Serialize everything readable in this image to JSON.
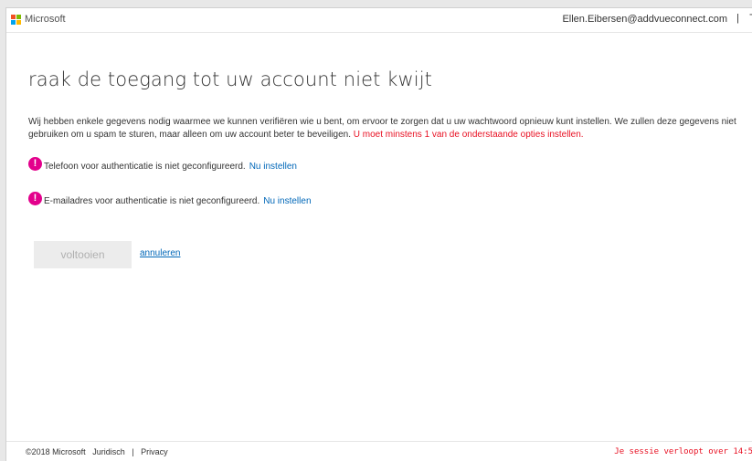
{
  "header": {
    "brand": "Microsoft",
    "logo_colors": [
      "#f25022",
      "#7fba00",
      "#00a4ef",
      "#ffb900"
    ],
    "user_email": "Ellen.Eibersen@addvueconnect.com",
    "separator": "|",
    "edge_char": "T"
  },
  "main": {
    "title": "raak de toegang tot uw account niet kwijt",
    "intro_text": "Wij hebben enkele gegevens nodig waarmee we kunnen verifiëren wie u bent, om ervoor te zorgen dat u uw wachtwoord opnieuw kunt instellen. We zullen deze gegevens niet gebruiken om u spam te sturen, maar alleen om uw account beter te beveiligen.",
    "intro_warning": "U moet minstens 1 van de onderstaande opties instellen.",
    "requirements": [
      {
        "icon": "alert-icon",
        "text": "Telefoon voor authenticatie is niet geconfigureerd.",
        "link": "Nu instellen"
      },
      {
        "icon": "alert-icon",
        "text": "E-mailadres voor authenticatie is niet geconfigureerd.",
        "link": "Nu instellen"
      }
    ],
    "finish_label": "voltooien",
    "cancel_label": "annuleren"
  },
  "footer": {
    "copyright": "©2018 Microsoft",
    "legal": "Juridisch",
    "separator": "|",
    "privacy": "Privacy",
    "session_text": "Je sessie verloopt over 14:5"
  },
  "colors": {
    "accent_link": "#0067b8",
    "warning_red": "#e81123",
    "alert_icon": "#e3008c"
  }
}
